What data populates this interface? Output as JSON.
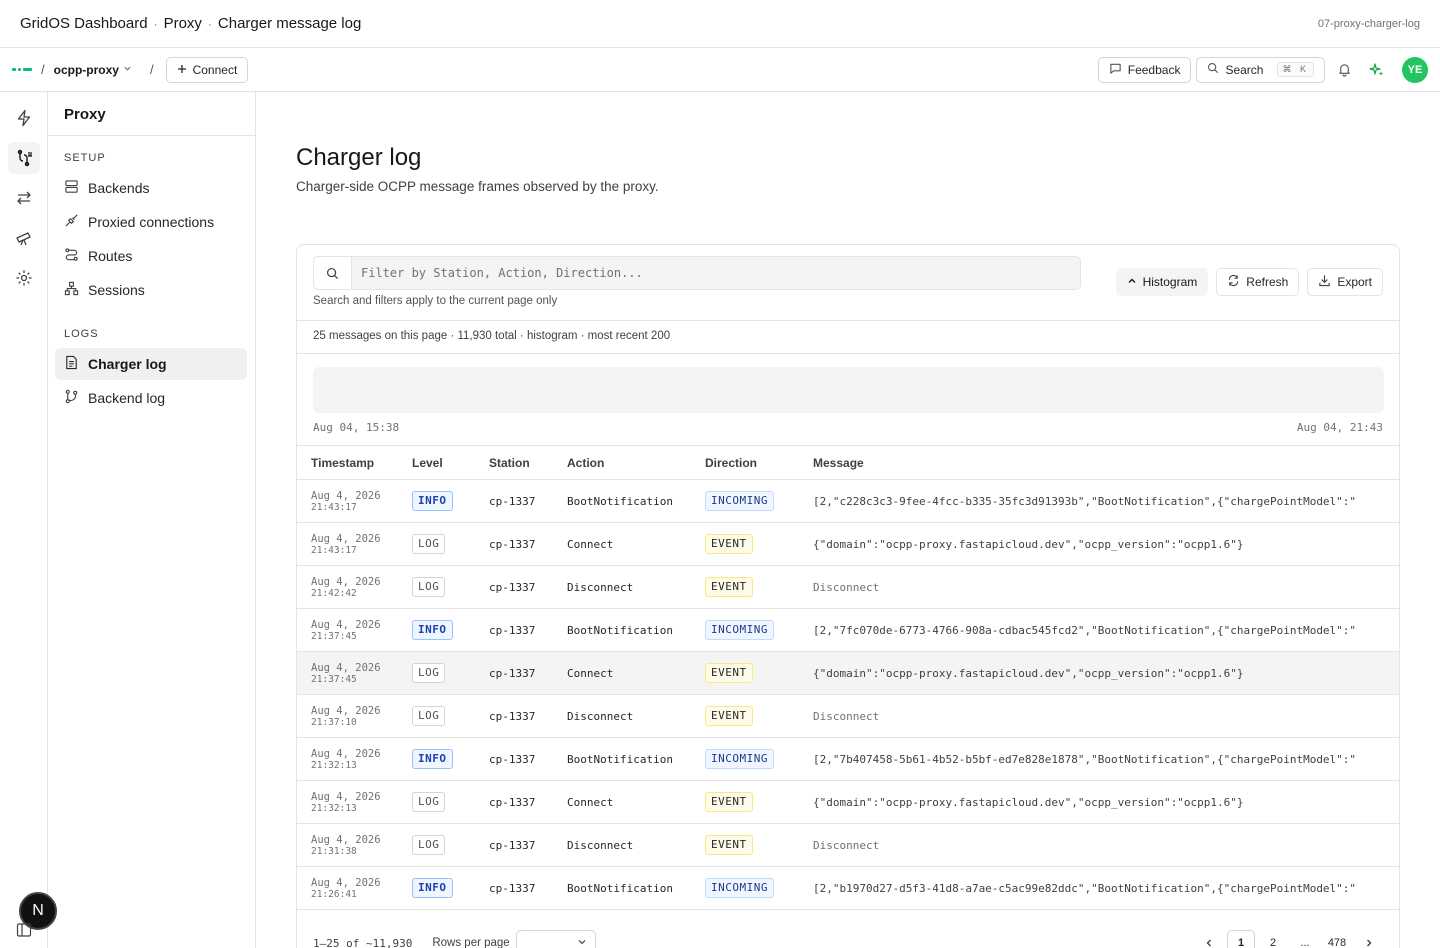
{
  "window": {
    "app": "GridOS Dashboard",
    "section": "Proxy",
    "page": "Charger message log",
    "tab_id": "07-proxy-charger-log"
  },
  "topbar": {
    "project": "ocpp-proxy",
    "connect_label": "Connect",
    "feedback_label": "Feedback",
    "search_label": "Search",
    "search_shortcut": "⌘ K",
    "avatar_initials": "YE"
  },
  "sidebar": {
    "title": "Proxy",
    "setup_label": "SETUP",
    "logs_label": "LOGS",
    "setup_items": [
      {
        "label": "Backends",
        "icon": "server-icon"
      },
      {
        "label": "Proxied connections",
        "icon": "plug-icon"
      },
      {
        "label": "Routes",
        "icon": "routes-icon"
      },
      {
        "label": "Sessions",
        "icon": "sessions-icon"
      }
    ],
    "log_items": [
      {
        "label": "Charger log",
        "icon": "file-text-icon",
        "active": true
      },
      {
        "label": "Backend log",
        "icon": "git-branch-icon",
        "active": false
      }
    ]
  },
  "main": {
    "title": "Charger log",
    "subtitle": "Charger-side OCPP message frames observed by the proxy.",
    "filter_placeholder": "Filter by Station, Action, Direction...",
    "filter_hint": "Search and filters apply to the current page only",
    "histogram_label": "Histogram",
    "refresh_label": "Refresh",
    "export_label": "Export",
    "summary": "25 messages on this page · 11,930 total · histogram · most recent 200",
    "histo_start": "Aug 04, 15:38",
    "histo_end": "Aug 04, 21:43",
    "columns": [
      "Timestamp",
      "Level",
      "Station",
      "Action",
      "Direction",
      "Message"
    ],
    "rows": [
      {
        "date": "Aug 4, 2026",
        "time": "21:43:17",
        "level": "INFO",
        "station": "cp-1337",
        "action": "BootNotification",
        "direction": "INCOMING",
        "message": "[2,\"c228c3c3-9fee-4fcc-b335-35fc3d91393b\",\"BootNotification\",{\"chargePointModel\":\""
      },
      {
        "date": "Aug 4, 2026",
        "time": "21:43:17",
        "level": "LOG",
        "station": "cp-1337",
        "action": "Connect",
        "direction": "EVENT",
        "message": "{\"domain\":\"ocpp-proxy.fastapicloud.dev\",\"ocpp_version\":\"ocpp1.6\"}"
      },
      {
        "date": "Aug 4, 2026",
        "time": "21:42:42",
        "level": "LOG",
        "station": "cp-1337",
        "action": "Disconnect",
        "direction": "EVENT",
        "message": "Disconnect"
      },
      {
        "date": "Aug 4, 2026",
        "time": "21:37:45",
        "level": "INFO",
        "station": "cp-1337",
        "action": "BootNotification",
        "direction": "INCOMING",
        "message": "[2,\"7fc070de-6773-4766-908a-cdbac545fcd2\",\"BootNotification\",{\"chargePointModel\":\""
      },
      {
        "date": "Aug 4, 2026",
        "time": "21:37:45",
        "level": "LOG",
        "station": "cp-1337",
        "action": "Connect",
        "direction": "EVENT",
        "message": "{\"domain\":\"ocpp-proxy.fastapicloud.dev\",\"ocpp_version\":\"ocpp1.6\"}"
      },
      {
        "date": "Aug 4, 2026",
        "time": "21:37:10",
        "level": "LOG",
        "station": "cp-1337",
        "action": "Disconnect",
        "direction": "EVENT",
        "message": "Disconnect"
      },
      {
        "date": "Aug 4, 2026",
        "time": "21:32:13",
        "level": "INFO",
        "station": "cp-1337",
        "action": "BootNotification",
        "direction": "INCOMING",
        "message": "[2,\"7b407458-5b61-4b52-b5bf-ed7e828e1878\",\"BootNotification\",{\"chargePointModel\":\""
      },
      {
        "date": "Aug 4, 2026",
        "time": "21:32:13",
        "level": "LOG",
        "station": "cp-1337",
        "action": "Connect",
        "direction": "EVENT",
        "message": "{\"domain\":\"ocpp-proxy.fastapicloud.dev\",\"ocpp_version\":\"ocpp1.6\"}"
      },
      {
        "date": "Aug 4, 2026",
        "time": "21:31:38",
        "level": "LOG",
        "station": "cp-1337",
        "action": "Disconnect",
        "direction": "EVENT",
        "message": "Disconnect"
      },
      {
        "date": "Aug 4, 2026",
        "time": "21:26:41",
        "level": "INFO",
        "station": "cp-1337",
        "action": "BootNotification",
        "direction": "INCOMING",
        "message": "[2,\"b1970d27-d5f3-41d8-a7ae-c5ac99e82ddc\",\"BootNotification\",{\"chargePointModel\":\""
      }
    ],
    "footer": {
      "range": "1–25 of ~11,930",
      "rows_per_page_label": "Rows per page",
      "pages": [
        "1",
        "2",
        "...",
        "478"
      ]
    }
  },
  "rail": {
    "bottom_badge": "N"
  },
  "colors": {
    "accent": "#10b981",
    "info_badge": "#1e40af",
    "event_badge_bg": "#fefce8"
  }
}
